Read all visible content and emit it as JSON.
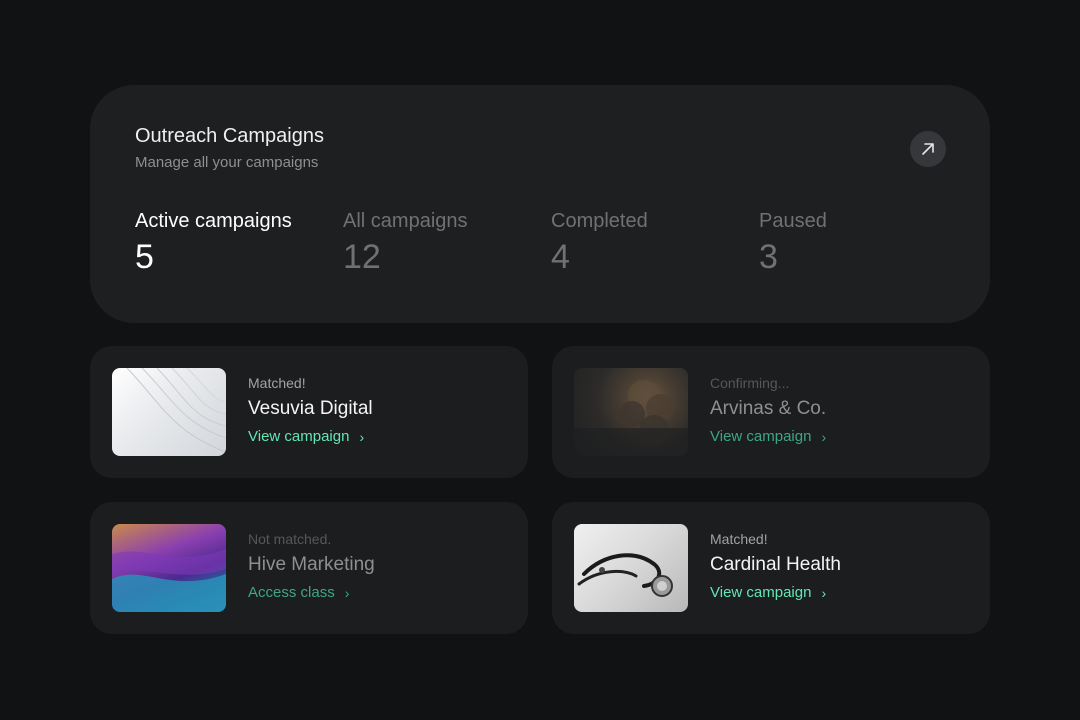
{
  "header": {
    "title": "Outreach Campaigns",
    "subtitle": "Manage all your campaigns",
    "open_icon": "arrow-up-right-icon"
  },
  "stats": [
    {
      "label": "Active campaigns",
      "value": "5"
    },
    {
      "label": "All campaigns",
      "value": "12"
    },
    {
      "label": "Completed",
      "value": "4"
    },
    {
      "label": "Paused",
      "value": "3"
    }
  ],
  "cards": [
    {
      "status": "Matched!",
      "name": "Vesuvia Digital",
      "link": "View campaign",
      "link_icon": "chevron-right-icon"
    },
    {
      "status": "Confirming...",
      "name": "Arvinas & Co.",
      "link": "View campaign",
      "link_icon": "chevron-right-icon"
    },
    {
      "status": "Not matched.",
      "name": "Hive Marketing",
      "link": "Access class",
      "link_icon": "chevron-right-icon"
    },
    {
      "status": "Matched!",
      "name": "Cardinal Health",
      "link": "View campaign",
      "link_icon": "chevron-right-icon"
    }
  ],
  "colors": {
    "background": "#111214",
    "panel": "#1e1f21",
    "accent": "#63e6b4"
  }
}
